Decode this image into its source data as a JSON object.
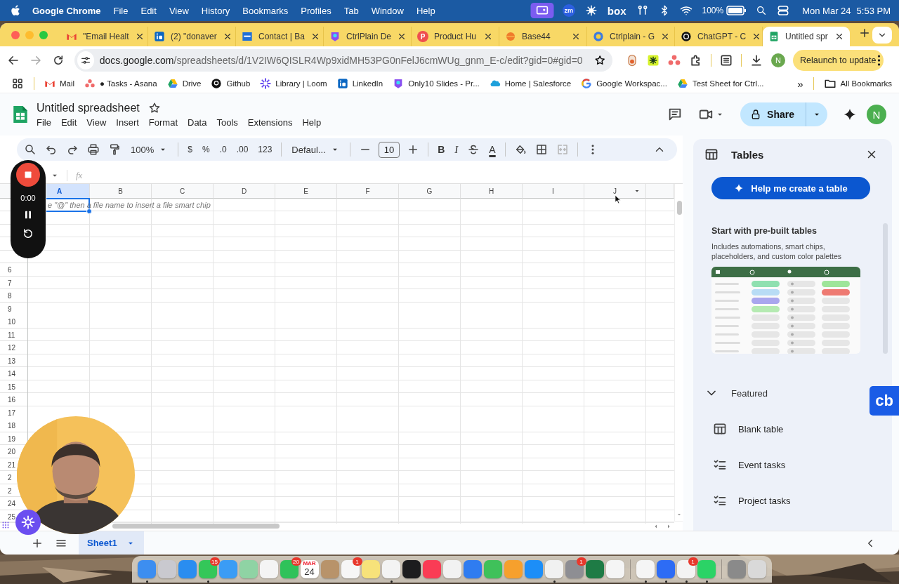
{
  "menubar": {
    "app": "Google Chrome",
    "menus": [
      "File",
      "Edit",
      "View",
      "History",
      "Bookmarks",
      "Profiles",
      "Tab",
      "Window",
      "Help"
    ],
    "status_items": [
      {
        "kind": "screen"
      },
      {
        "kind": "badge",
        "label": "zm"
      },
      {
        "kind": "asterisk"
      },
      {
        "kind": "wordmark",
        "label": "box"
      },
      {
        "kind": "earbuds"
      },
      {
        "kind": "bluetooth"
      },
      {
        "kind": "wifi"
      },
      {
        "kind": "battery",
        "label": "100%"
      },
      {
        "kind": "search"
      },
      {
        "kind": "toggles"
      }
    ],
    "date": "Mon Mar 24",
    "time": "5:53 PM"
  },
  "browser": {
    "tabs": [
      {
        "title": "\"Email Healt",
        "kind": "gmail",
        "selected": false
      },
      {
        "title": "(2) \"donaver",
        "kind": "linkedin",
        "selected": false
      },
      {
        "title": "Contact | Ba",
        "kind": "bcv",
        "selected": false
      },
      {
        "title": "CtrlPlain De",
        "kind": "ctrlplain",
        "selected": false
      },
      {
        "title": "Product Hu",
        "kind": "producthunt",
        "glyph": "P",
        "selected": false
      },
      {
        "title": "Base44",
        "kind": "base44",
        "selected": false
      },
      {
        "title": "Ctrlplain - G",
        "kind": "ctrlplain_g",
        "selected": false
      },
      {
        "title": "ChatGPT - C",
        "kind": "chatgpt",
        "selected": false
      },
      {
        "title": "Untitled spr",
        "kind": "sheets",
        "selected": true
      }
    ],
    "nav": {
      "back_enabled": true,
      "forward_enabled": false
    },
    "address": {
      "host": "docs.google.com",
      "path": "/spreadsheets/d/1V2IW6QISLR4Wp9xidMH53PG0nFelJ6cmWUg_gnm_E-c/edit?gid=0#gid=0"
    },
    "profile": "N",
    "relaunch": "Relaunch to update",
    "bookmarks": [
      {
        "label": "Mail",
        "kind": "gmail"
      },
      {
        "label": "● Tasks - Asana",
        "kind": "asana"
      },
      {
        "label": "Drive",
        "kind": "drive"
      },
      {
        "label": "Github",
        "kind": "github"
      },
      {
        "label": "Library | Loom",
        "kind": "loom"
      },
      {
        "label": "LinkedIn",
        "kind": "linkedin"
      },
      {
        "label": "Only10 Slides - Pr...",
        "kind": "ctrlplain"
      },
      {
        "label": "Home | Salesforce",
        "kind": "salesforce"
      },
      {
        "label": "Google Workspac...",
        "kind": "google"
      },
      {
        "label": "Test Sheet for Ctrl...",
        "kind": "drive"
      }
    ],
    "overflow": "»",
    "all_bookmarks": "All Bookmarks"
  },
  "sheets": {
    "title": "Untitled spreadsheet",
    "menus": [
      "File",
      "Edit",
      "View",
      "Insert",
      "Format",
      "Data",
      "Tools",
      "Extensions",
      "Help"
    ],
    "share": "Share",
    "account": "N",
    "toolbar": [
      {
        "kind": "search"
      },
      {
        "kind": "undo"
      },
      {
        "kind": "redo"
      },
      {
        "kind": "print"
      },
      {
        "kind": "paint_format"
      },
      {
        "kind": "select",
        "label": "100%"
      },
      {
        "kind": "separator"
      },
      {
        "kind": "text",
        "label": "$"
      },
      {
        "kind": "text",
        "label": "%"
      },
      {
        "kind": "text",
        "label": ".0"
      },
      {
        "kind": "text",
        "label": ".00"
      },
      {
        "kind": "text",
        "label": "123"
      },
      {
        "kind": "separator"
      },
      {
        "kind": "select",
        "label": "Defaul..."
      },
      {
        "kind": "separator"
      },
      {
        "kind": "minus"
      },
      {
        "kind": "size",
        "label": "10"
      },
      {
        "kind": "plus"
      },
      {
        "kind": "separator"
      },
      {
        "kind": "bold",
        "label": "B"
      },
      {
        "kind": "italic",
        "label": "I"
      },
      {
        "kind": "strike"
      },
      {
        "kind": "text_color",
        "label": "A"
      },
      {
        "kind": "separator"
      },
      {
        "kind": "fill"
      },
      {
        "kind": "borders"
      },
      {
        "kind": "merge"
      },
      {
        "kind": "separator"
      },
      {
        "kind": "more"
      }
    ],
    "formula_label": "fx",
    "columns": [
      {
        "label": "A",
        "selected": true,
        "menu": false
      },
      {
        "label": "B",
        "selected": false,
        "menu": false
      },
      {
        "label": "C",
        "selected": false,
        "menu": false
      },
      {
        "label": "D",
        "selected": false,
        "menu": false
      },
      {
        "label": "E",
        "selected": false,
        "menu": false
      },
      {
        "label": "F",
        "selected": false,
        "menu": false
      },
      {
        "label": "G",
        "selected": false,
        "menu": false
      },
      {
        "label": "H",
        "selected": false,
        "menu": false
      },
      {
        "label": "I",
        "selected": false,
        "menu": false
      },
      {
        "label": "J",
        "selected": false,
        "menu": true
      }
    ],
    "cell_placeholder": "e \"@\" then a file name to insert a file smart chip",
    "row_numbers": [
      "6",
      "7",
      "8",
      "9",
      "10",
      "11",
      "12",
      "13",
      "14",
      "15",
      "16",
      "17",
      "18",
      "19",
      "20",
      "21",
      "2",
      "2",
      "24",
      "25"
    ],
    "sheet_tabs": [
      {
        "name": "Sheet1",
        "selected": true
      }
    ]
  },
  "recorder": {
    "elapsed": "0:00"
  },
  "tables_panel": {
    "title": "Tables",
    "help_button": "Help me create a table",
    "prebuilt_heading": "Start with pre-built tables",
    "prebuilt_description": "Includes automations, smart chips, placeholders, and custom color palettes",
    "featured": {
      "label": "Featured",
      "expanded": true,
      "items": [
        {
          "label": "Blank table",
          "kind": "table"
        },
        {
          "label": "Event tasks",
          "kind": "tasks"
        },
        {
          "label": "Project tasks",
          "kind": "tasks"
        }
      ]
    }
  },
  "side_badge": "cb",
  "dock": [
    {
      "kind": "app",
      "color": "#3d8ef0",
      "running": true
    },
    {
      "kind": "app",
      "color": "#c9c9cf",
      "running": false
    },
    {
      "kind": "app",
      "color": "#2a8df0",
      "running": false
    },
    {
      "kind": "app",
      "color": "#34c759",
      "badge": "15",
      "running": true
    },
    {
      "kind": "app",
      "color": "#3b9cf5",
      "running": false
    },
    {
      "kind": "app",
      "color": "#8fd3a4",
      "running": false
    },
    {
      "kind": "app",
      "color": "#f4f4f4",
      "running": false
    },
    {
      "kind": "app",
      "color": "#2fc25a",
      "badge": "20",
      "running": false
    },
    {
      "kind": "calendar",
      "month": "MAR",
      "day": "24",
      "running": false
    },
    {
      "kind": "app",
      "color": "#b8936a",
      "running": false
    },
    {
      "kind": "app",
      "color": "#f6f6f6",
      "badge": "1",
      "running": false
    },
    {
      "kind": "app",
      "color": "#f7e27a",
      "running": false
    },
    {
      "kind": "app",
      "color": "#f3f3f3",
      "running": true
    },
    {
      "kind": "app",
      "color": "#1c1c1e",
      "running": false
    },
    {
      "kind": "app",
      "color": "#fa3c55",
      "running": false
    },
    {
      "kind": "app",
      "color": "#f2f2f2",
      "running": false
    },
    {
      "kind": "app",
      "color": "#2f7cf0",
      "running": false
    },
    {
      "kind": "app",
      "color": "#3fc15a",
      "running": false
    },
    {
      "kind": "app",
      "color": "#f6a02d",
      "running": false
    },
    {
      "kind": "app",
      "color": "#1c8ef8",
      "running": false
    },
    {
      "kind": "app",
      "color": "#f1f1f1",
      "running": true
    },
    {
      "kind": "app",
      "color": "#8e8e93",
      "badge": "1",
      "running": false
    },
    {
      "kind": "app",
      "color": "#1e7b45",
      "running": false
    },
    {
      "kind": "app",
      "color": "#f5f5f5",
      "running": false
    },
    {
      "kind": "separator"
    },
    {
      "kind": "app",
      "color": "#f5f5f5",
      "running": true
    },
    {
      "kind": "app",
      "color": "#2d6cf5",
      "running": true
    },
    {
      "kind": "app",
      "color": "#f3f3f3",
      "badge": "1",
      "running": true
    },
    {
      "kind": "app",
      "color": "#2bd366",
      "running": true
    },
    {
      "kind": "separator"
    },
    {
      "kind": "app",
      "color": "#8a8a8a",
      "running": false
    },
    {
      "kind": "app",
      "color": "#d9d9d9",
      "running": false
    }
  ]
}
